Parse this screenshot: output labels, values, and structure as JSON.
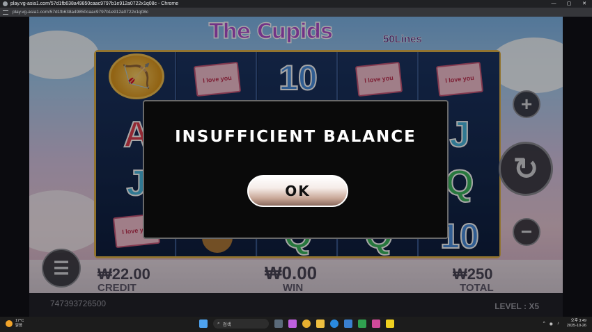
{
  "browser": {
    "title": "play.vg-asia1.com/57d1fb638a49850caac9797b1e912a0722x1q08c - Chrome",
    "url": "play.vg-asia1.com/57d1fb638a49850caac9797b1e912a0722x1q08c",
    "controls": {
      "minimize": "—",
      "maximize": "▢",
      "close": "✕"
    }
  },
  "game": {
    "logo": "The Cupids",
    "lines": "50Lines",
    "reels": [
      [
        "badge",
        "letterA",
        "letterJ",
        "env"
      ],
      [
        "env",
        "letterA",
        "letterQ",
        "bear"
      ],
      [
        "ten",
        "letterA",
        "letterJ",
        "letterQ"
      ],
      [
        "env",
        "letterQ",
        "letterJ",
        "letterQ"
      ],
      [
        "env",
        "letterJ",
        "letterQ",
        "ten"
      ]
    ],
    "symbols": {
      "env": "I love you",
      "ten": "10",
      "letterA": "A",
      "letterJ": "J",
      "letterQ": "Q",
      "badge": "🏹"
    },
    "buttons": {
      "plus": "+",
      "minus": "−",
      "spin": "↻",
      "menu": "☰"
    },
    "credit_value": "₩22.00",
    "credit_label": "CREDIT",
    "win_value": "₩0.00",
    "win_label": "WIN",
    "total_value": "₩250",
    "total_label": "TOTAL",
    "account_id": "747393726500",
    "level": "LEVEL : X5"
  },
  "modal": {
    "message": "INSUFFICIENT BALANCE",
    "ok_label": "OK"
  },
  "taskbar": {
    "temp": "17°C",
    "weather": "맑음",
    "search_placeholder": "검색",
    "time": "오후 3:49",
    "date": "2025-10-26"
  }
}
